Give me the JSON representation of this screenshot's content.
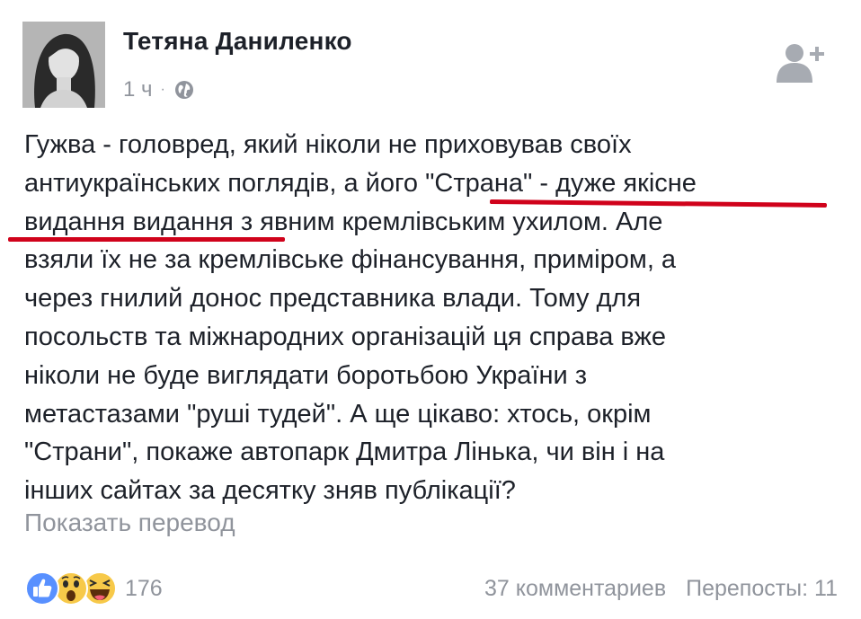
{
  "post": {
    "author": "Тетяна Даниленко",
    "time": "1 ч",
    "separator": "·",
    "privacy_icon": "globe-icon",
    "lines": [
      "Гужва - головред, який ніколи не приховував своїх",
      "антиукраїнських поглядів, а його \"Страна\" - дуже якісне",
      "видання видання з явним кремлівським ухилом. Але",
      "взяли їх не за кремлівське фінансування, приміром, а",
      "через гнилий донос представника влади. Тому для",
      "посольств та міжнародних організацій ця справа вже",
      "ніколи не буде виглядати боротьбою України з",
      "метастазами \"руші тудей\". А ще цікаво: хтось, окрім",
      "\"Страни\", покаже автопарк Дмитра Лінька, чи він і на",
      "інших сайтах за десятку зняв публікації?"
    ],
    "translate_link": "Показать перевод"
  },
  "footer": {
    "reaction_icons": [
      "like-icon",
      "wow-icon",
      "haha-icon"
    ],
    "reaction_count": "176",
    "comments": "37 комментариев",
    "shares": "Перепосты: 11"
  },
  "colors": {
    "text": "#1d2129",
    "muted": "#90949c",
    "underline": "#d0021b",
    "like_blue": "#5890ff",
    "emoji_yellow": "#f7c949"
  }
}
